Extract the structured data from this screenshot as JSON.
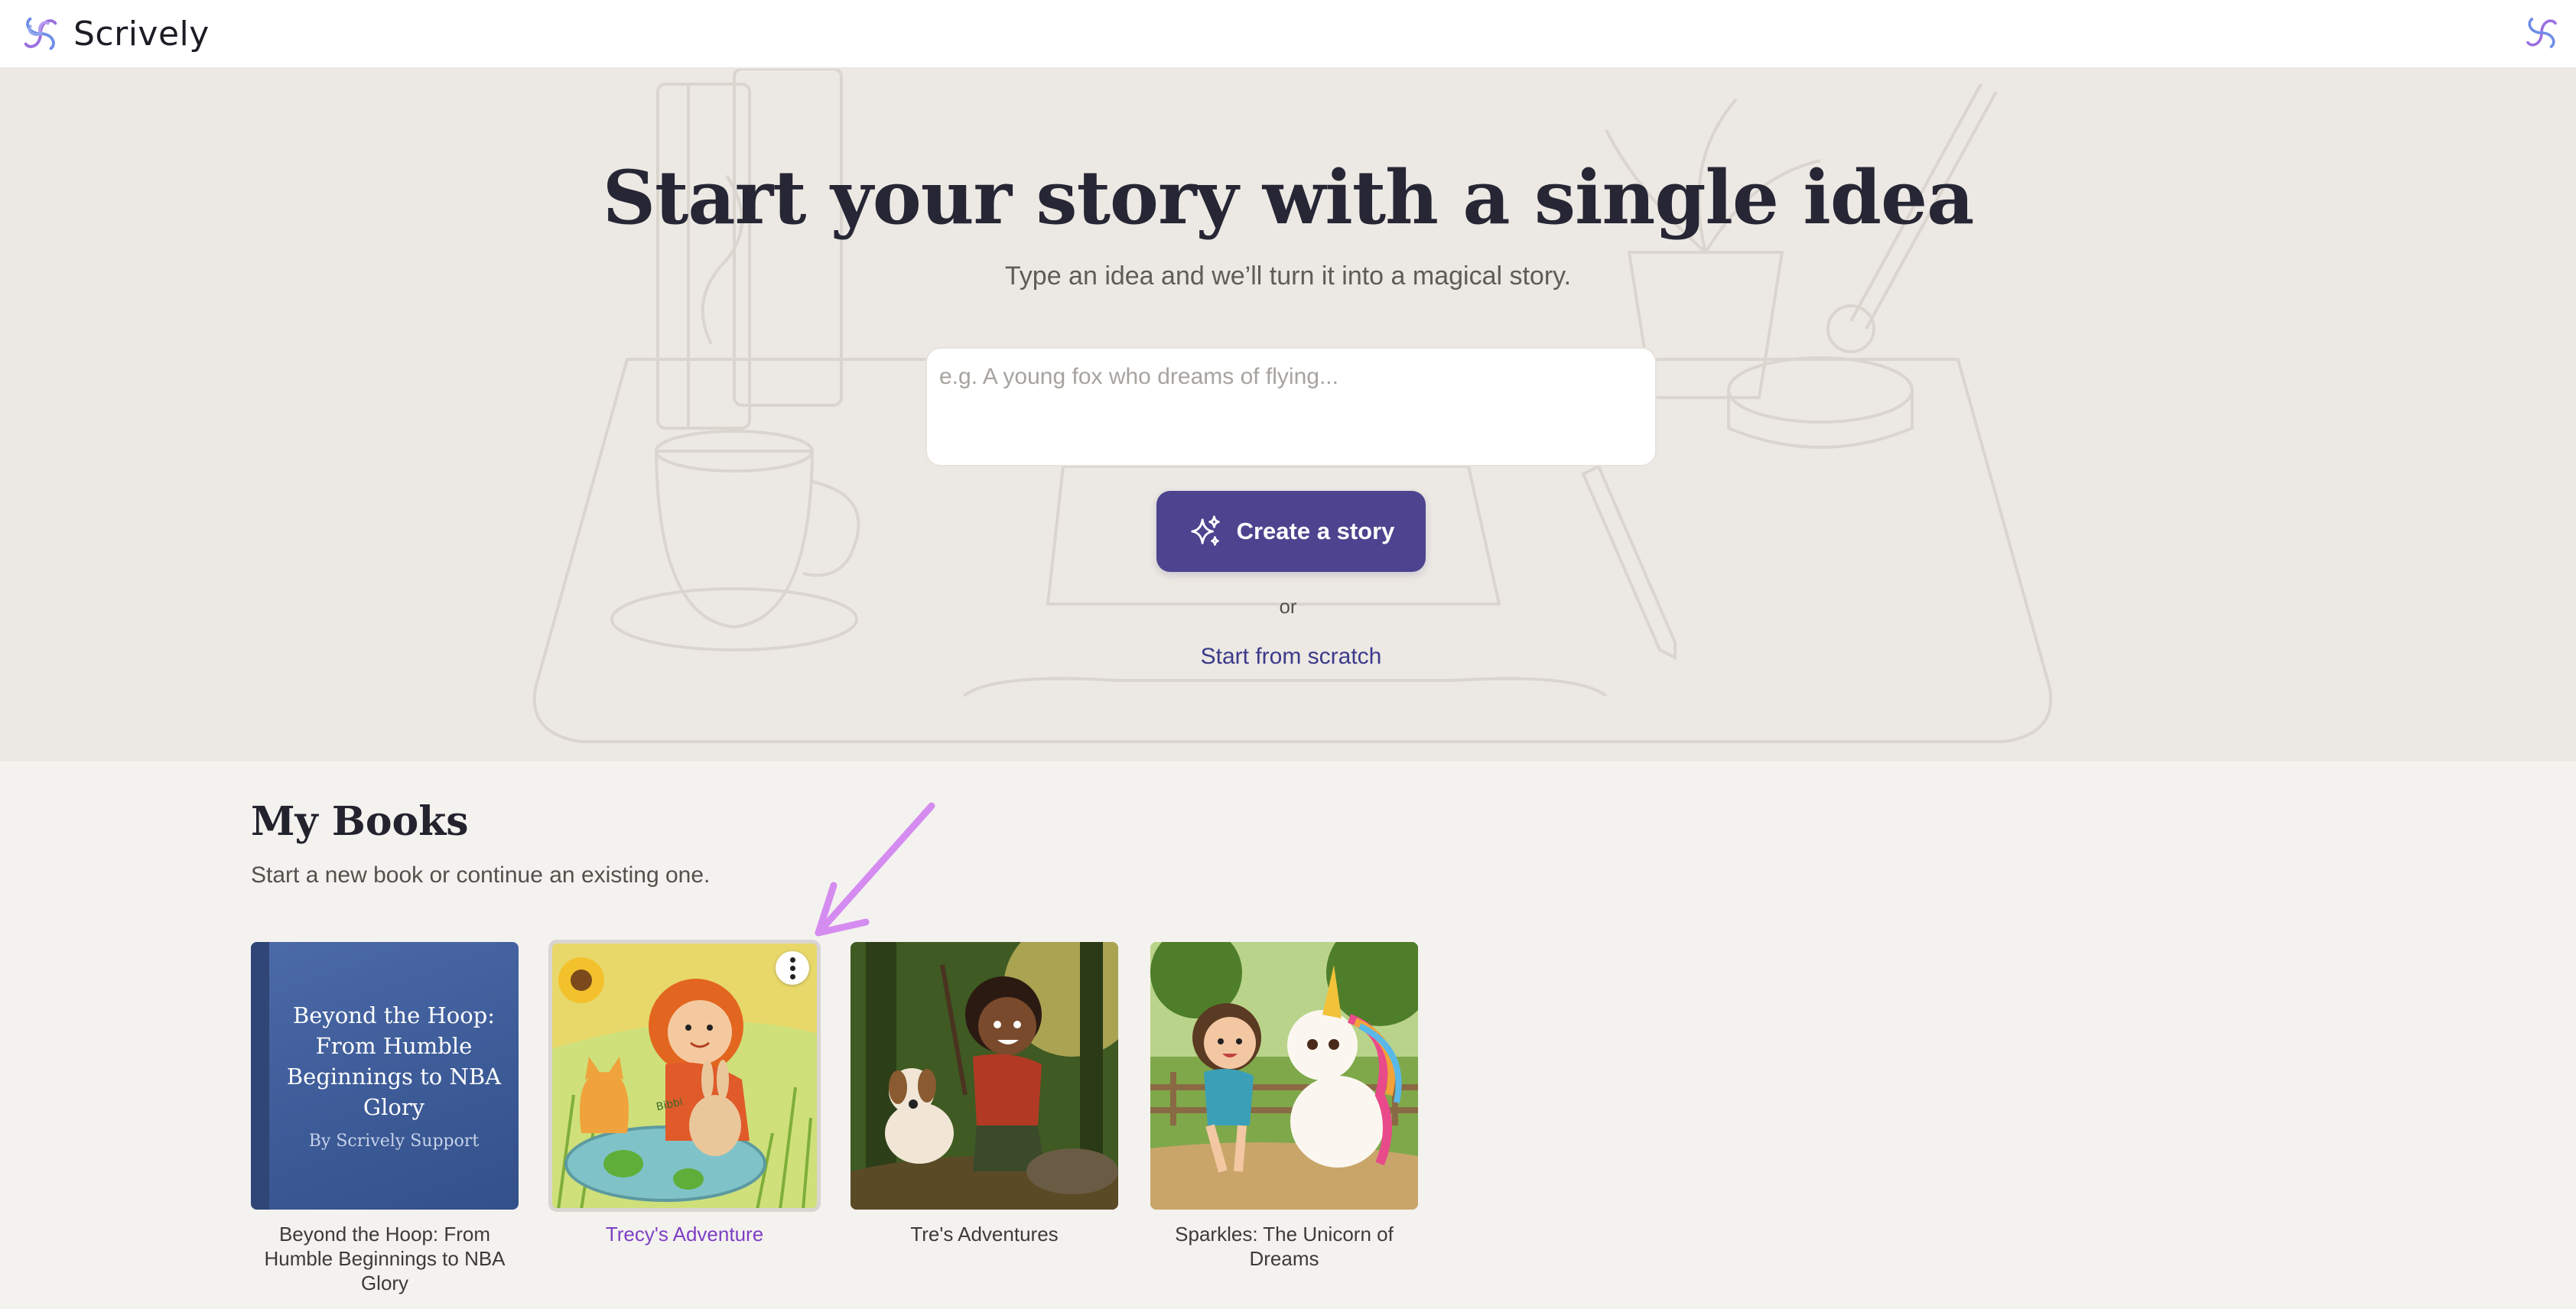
{
  "app": {
    "name": "Scrively",
    "brand_colors": {
      "violet": "#9b6fe0",
      "blue": "#6f8de8",
      "button": "#4c448f"
    }
  },
  "header": {
    "logo_icon": "swirl-logo-icon",
    "account_icon": "swirl-logo-icon"
  },
  "hero": {
    "title": "Start your story with a single idea",
    "subtitle": "Type an idea and we’ll turn it into a magical story.",
    "idea_input": {
      "value": "",
      "placeholder": "e.g. A young fox who dreams of flying..."
    },
    "create_button": {
      "label": "Create a story",
      "icon": "sparkles-icon"
    },
    "or_text": "or",
    "scratch_link": "Start from scratch"
  },
  "my_books": {
    "title": "My Books",
    "subtitle": "Start a new book or continue an existing one.",
    "books": [
      {
        "caption": "Beyond the Hoop: From Humble Beginnings to NBA Glory",
        "cover_type": "text",
        "cover_title": "Beyond the Hoop: From Humble Beginnings to NBA Glory",
        "cover_author": "By Scrively Support",
        "cover_color": "#3c5a96"
      },
      {
        "caption": "Trecy's Adventure",
        "cover_type": "illustration",
        "cover_scene": "girl-with-cat-bunny-frogs",
        "cover_text": "Bibbi",
        "hovered": true,
        "menu_icon": "more-vertical-icon"
      },
      {
        "caption": "Tre's Adventures",
        "cover_type": "illustration",
        "cover_scene": "boy-with-dog-in-forest"
      },
      {
        "caption": "Sparkles: The Unicorn of Dreams",
        "cover_type": "illustration",
        "cover_scene": "girl-with-rainbow-unicorn"
      }
    ],
    "annotation_arrow_color": "#d58cf0"
  }
}
